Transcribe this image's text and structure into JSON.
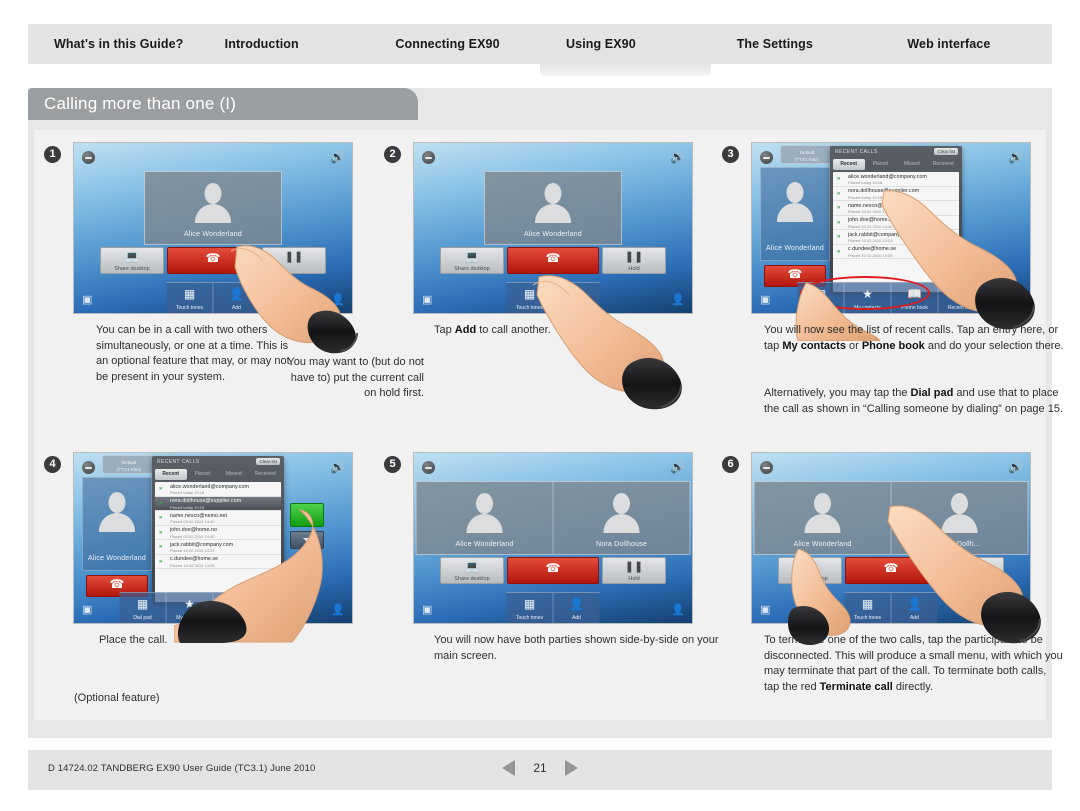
{
  "nav": {
    "tabs": [
      {
        "label": "What's in this Guide?",
        "active": false
      },
      {
        "label": "Introduction",
        "active": false
      },
      {
        "label": "Connecting EX90",
        "active": false
      },
      {
        "label": "Using EX90",
        "active": true
      },
      {
        "label": "The Settings",
        "active": false
      },
      {
        "label": "Web interface",
        "active": false
      }
    ]
  },
  "section": {
    "title": "Calling more than one (I)"
  },
  "steps": [
    {
      "num": "❶",
      "caption_main": "You can be in a call with two others simultaneously, or one at a time. This is an optional feature that may, or may not, be present in your system.",
      "caption_side": "You may want to (but do not have to) put the current call on hold first."
    },
    {
      "num": "❷",
      "caption_pre": "Tap ",
      "caption_bold": "Add",
      "caption_post": " to call another."
    },
    {
      "num": "❸",
      "p1_a": "You will now see the list of recent calls. Tap an entry here, or tap ",
      "p1_b1": "My contacts",
      "p1_c": " or ",
      "p1_b2": "Phone book",
      "p1_d": " and do your selection there.",
      "p2_a": "Alternatively, you may tap the ",
      "p2_b": "Dial pad",
      "p2_c": " and use that to place the call as shown in “Calling someone by dialing” on page 15."
    },
    {
      "num": "❹",
      "caption": "Place the call.",
      "note": "(Optional feature)"
    },
    {
      "num": "❺",
      "caption": "You will now have both parties shown side-by-side on your main screen."
    },
    {
      "num": "❻",
      "p_a": "To terminate one of the two calls, tap the participant to be disconnected. This will produce a small menu, with which you may terminate that part of the call. To terminate both calls, tap the red ",
      "p_b": "Terminate call",
      "p_c": " directly."
    }
  ],
  "device": {
    "participants": {
      "alice": "Alice Wonderland",
      "nora": "Nora Dollhouse",
      "nora_short": "Nora Dollh..."
    },
    "controls": {
      "presentation": "Share desktop",
      "hangup_glyph": "☎",
      "add_label": "Add",
      "hold_label": "Hold",
      "hold_glyph": "❚❚"
    },
    "dock": [
      {
        "glyph": "∷",
        "label": "Touch tones"
      },
      {
        "glyph": "☺",
        "label": "Add"
      }
    ],
    "dock_full": [
      {
        "glyph": "∷",
        "label": "Dial pad"
      },
      {
        "glyph": "★",
        "label": "My contacts"
      },
      {
        "glyph": "☷",
        "label": "Phone book"
      },
      {
        "glyph": "♪",
        "label": "Recent calls"
      }
    ],
    "status_pill": "Default\n(TTS1 Klas)"
  },
  "recent_calls": {
    "header": "RECENT CALLS",
    "clear": "Clear list",
    "tabs": [
      "Recent",
      "Placed",
      "Missed",
      "Received"
    ],
    "active_tab": "Recent",
    "entries": [
      {
        "address": "alice.wonderland@company.com",
        "detail": "Placed today 10:18"
      },
      {
        "address": "nora.dollhouse@supplier.com",
        "detail": "Placed today 10:18"
      },
      {
        "address": "name.nesco@nemo.net",
        "detail": "Placed 03.02.2010 14:40"
      },
      {
        "address": "john.doe@home.no",
        "detail": "Placed 03.02.2010 14:40"
      },
      {
        "address": "jack.rabbit@company.com",
        "detail": "Placed 10.02.2010 13:29"
      },
      {
        "address": "c.dundee@home.se",
        "detail": "Placed 10.02.2010 13:05"
      }
    ]
  },
  "footer": {
    "doc_id": "D 14724.02 TANDBERG EX90 User Guide (TC3.1) June 2010",
    "page": "21",
    "prev_icon": "prev-page-arrow",
    "next_icon": "next-page-arrow"
  },
  "colors": {
    "nav_bg": "#e2e3e4",
    "sheet_bg": "#e6e7e8",
    "title_tab": "#9c9fa1",
    "accent_red": "#e01b1b",
    "hangup_red": "#c11a0d",
    "call_green": "#22b523"
  }
}
